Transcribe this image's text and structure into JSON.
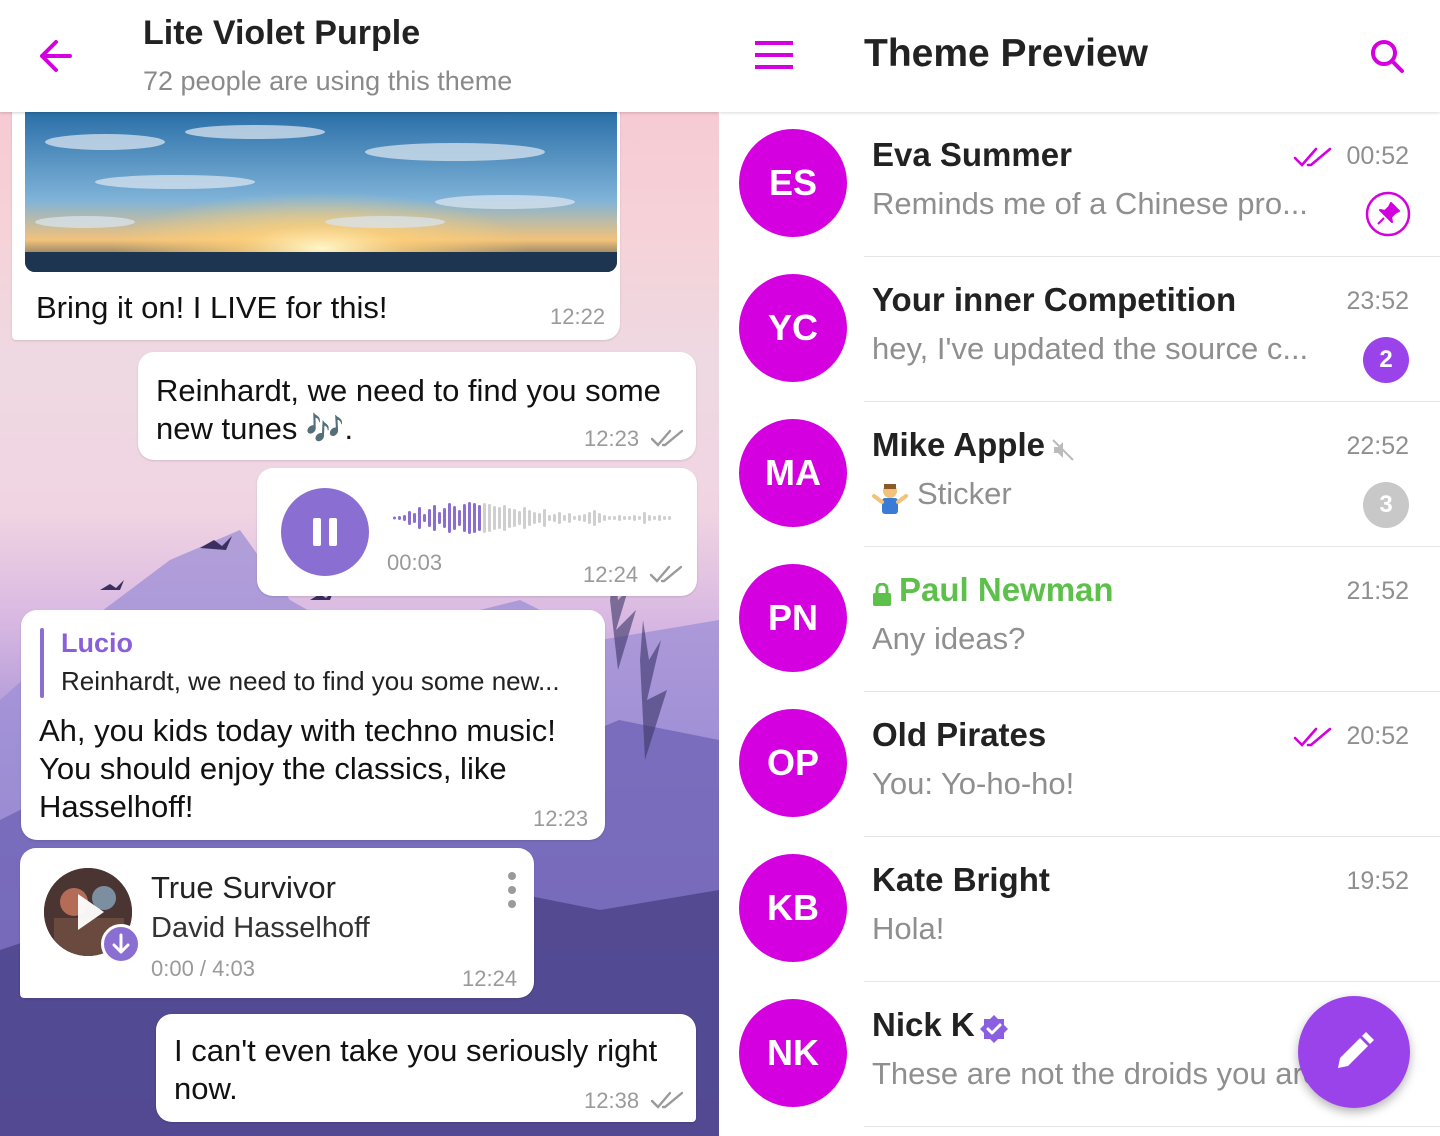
{
  "colors": {
    "accent": "#d400e0",
    "fab": "#9a43ea",
    "voice": "#8a6ed1",
    "online_secure": "#5cc04a",
    "muted_badge": "#c8c8c8",
    "unread_badge": "#9a43ea"
  },
  "chat_preview": {
    "header": {
      "back_icon": "arrow-left-icon",
      "title": "Lite Violet Purple",
      "subtitle": "72 people are using this theme"
    },
    "messages": {
      "photo": {
        "caption": "Bring it on! I LIVE for this!",
        "time": "12:22"
      },
      "tunes": {
        "text": "Reinhardt, we need to find you some new tunes 🎶.",
        "time": "12:23"
      },
      "voice": {
        "duration": "00:03",
        "time": "12:24",
        "icon": "pause-icon"
      },
      "reply": {
        "reply_name": "Lucio",
        "reply_quote": "Reinhardt, we need to find you some new...",
        "text": "Ah, you kids today with techno music! You should enjoy the classics, like Hasselhoff!",
        "time": "12:23"
      },
      "music": {
        "title": "True Survivor",
        "artist": "David Hasselhoff",
        "progress": "0:00 / 4:03",
        "time": "12:24"
      },
      "last": {
        "text": "I can't even take you seriously right now.",
        "time": "12:38"
      }
    }
  },
  "chat_list": {
    "header": {
      "title": "Theme Preview",
      "menu_icon": "hamburger-icon",
      "search_icon": "search-icon"
    },
    "rows": [
      {
        "initials": "ES",
        "name": "Eva Summer",
        "preview": "Reminds me of a Chinese pro...",
        "time": "00:52",
        "read": true,
        "pinned": true
      },
      {
        "initials": "YC",
        "name": "Your inner Competition",
        "preview": "hey, I've updated the source c...",
        "time": "23:52",
        "unread": "2"
      },
      {
        "initials": "MA",
        "name": "Mike Apple",
        "preview": "Sticker",
        "time": "22:52",
        "muted": true,
        "unread": "3"
      },
      {
        "initials": "PN",
        "name": "Paul Newman",
        "preview": "Any ideas?",
        "time": "21:52",
        "secret": true
      },
      {
        "initials": "OP",
        "name": "Old Pirates",
        "preview": "You: Yo-ho-ho!",
        "time": "20:52",
        "read": true
      },
      {
        "initials": "KB",
        "name": "Kate Bright",
        "preview": "Hola!",
        "time": "19:52"
      },
      {
        "initials": "NK",
        "name": "Nick K",
        "preview": "These are not the droids you are",
        "verified": true
      }
    ],
    "fab_icon": "pencil-icon"
  }
}
